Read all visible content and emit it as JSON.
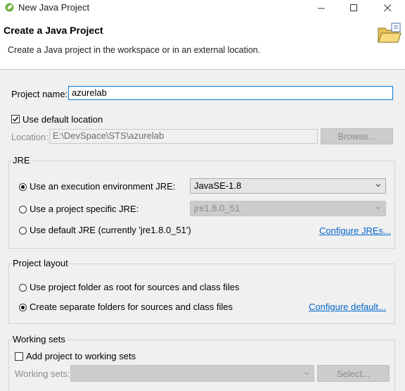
{
  "window": {
    "title": "New Java Project"
  },
  "header": {
    "title": "Create a Java Project",
    "description": "Create a Java project in the workspace or in an external location."
  },
  "project": {
    "name_label": "Project name:",
    "name_value": "azurelab",
    "use_default_location_label": "Use default location",
    "use_default_location_checked": true,
    "location_label": "Location:",
    "location_value": "E:\\DevSpace\\STS\\azurelab",
    "browse_label": "Browse..."
  },
  "jre": {
    "group_label": "JRE",
    "option_env_label": "Use an execution environment JRE:",
    "option_env_value": "JavaSE-1.8",
    "option_specific_label": "Use a project specific JRE:",
    "option_specific_value": "jre1.8.0_51",
    "option_default_label": "Use default JRE (currently 'jre1.8.0_51')",
    "configure_link": "Configure JREs...",
    "selected": "env"
  },
  "layout": {
    "group_label": "Project layout",
    "option_root_label": "Use project folder as root for sources and class files",
    "option_separate_label": "Create separate folders for sources and class files",
    "configure_link": "Configure default...",
    "selected": "separate"
  },
  "working_sets": {
    "group_label": "Working sets",
    "add_label": "Add project to working sets",
    "add_checked": false,
    "sets_label": "Working sets:",
    "sets_value": "",
    "select_label": "Select..."
  },
  "colors": {
    "link": "#0066cc",
    "focus_border": "#0078d7",
    "dialog_bg": "#f0f0f0"
  }
}
